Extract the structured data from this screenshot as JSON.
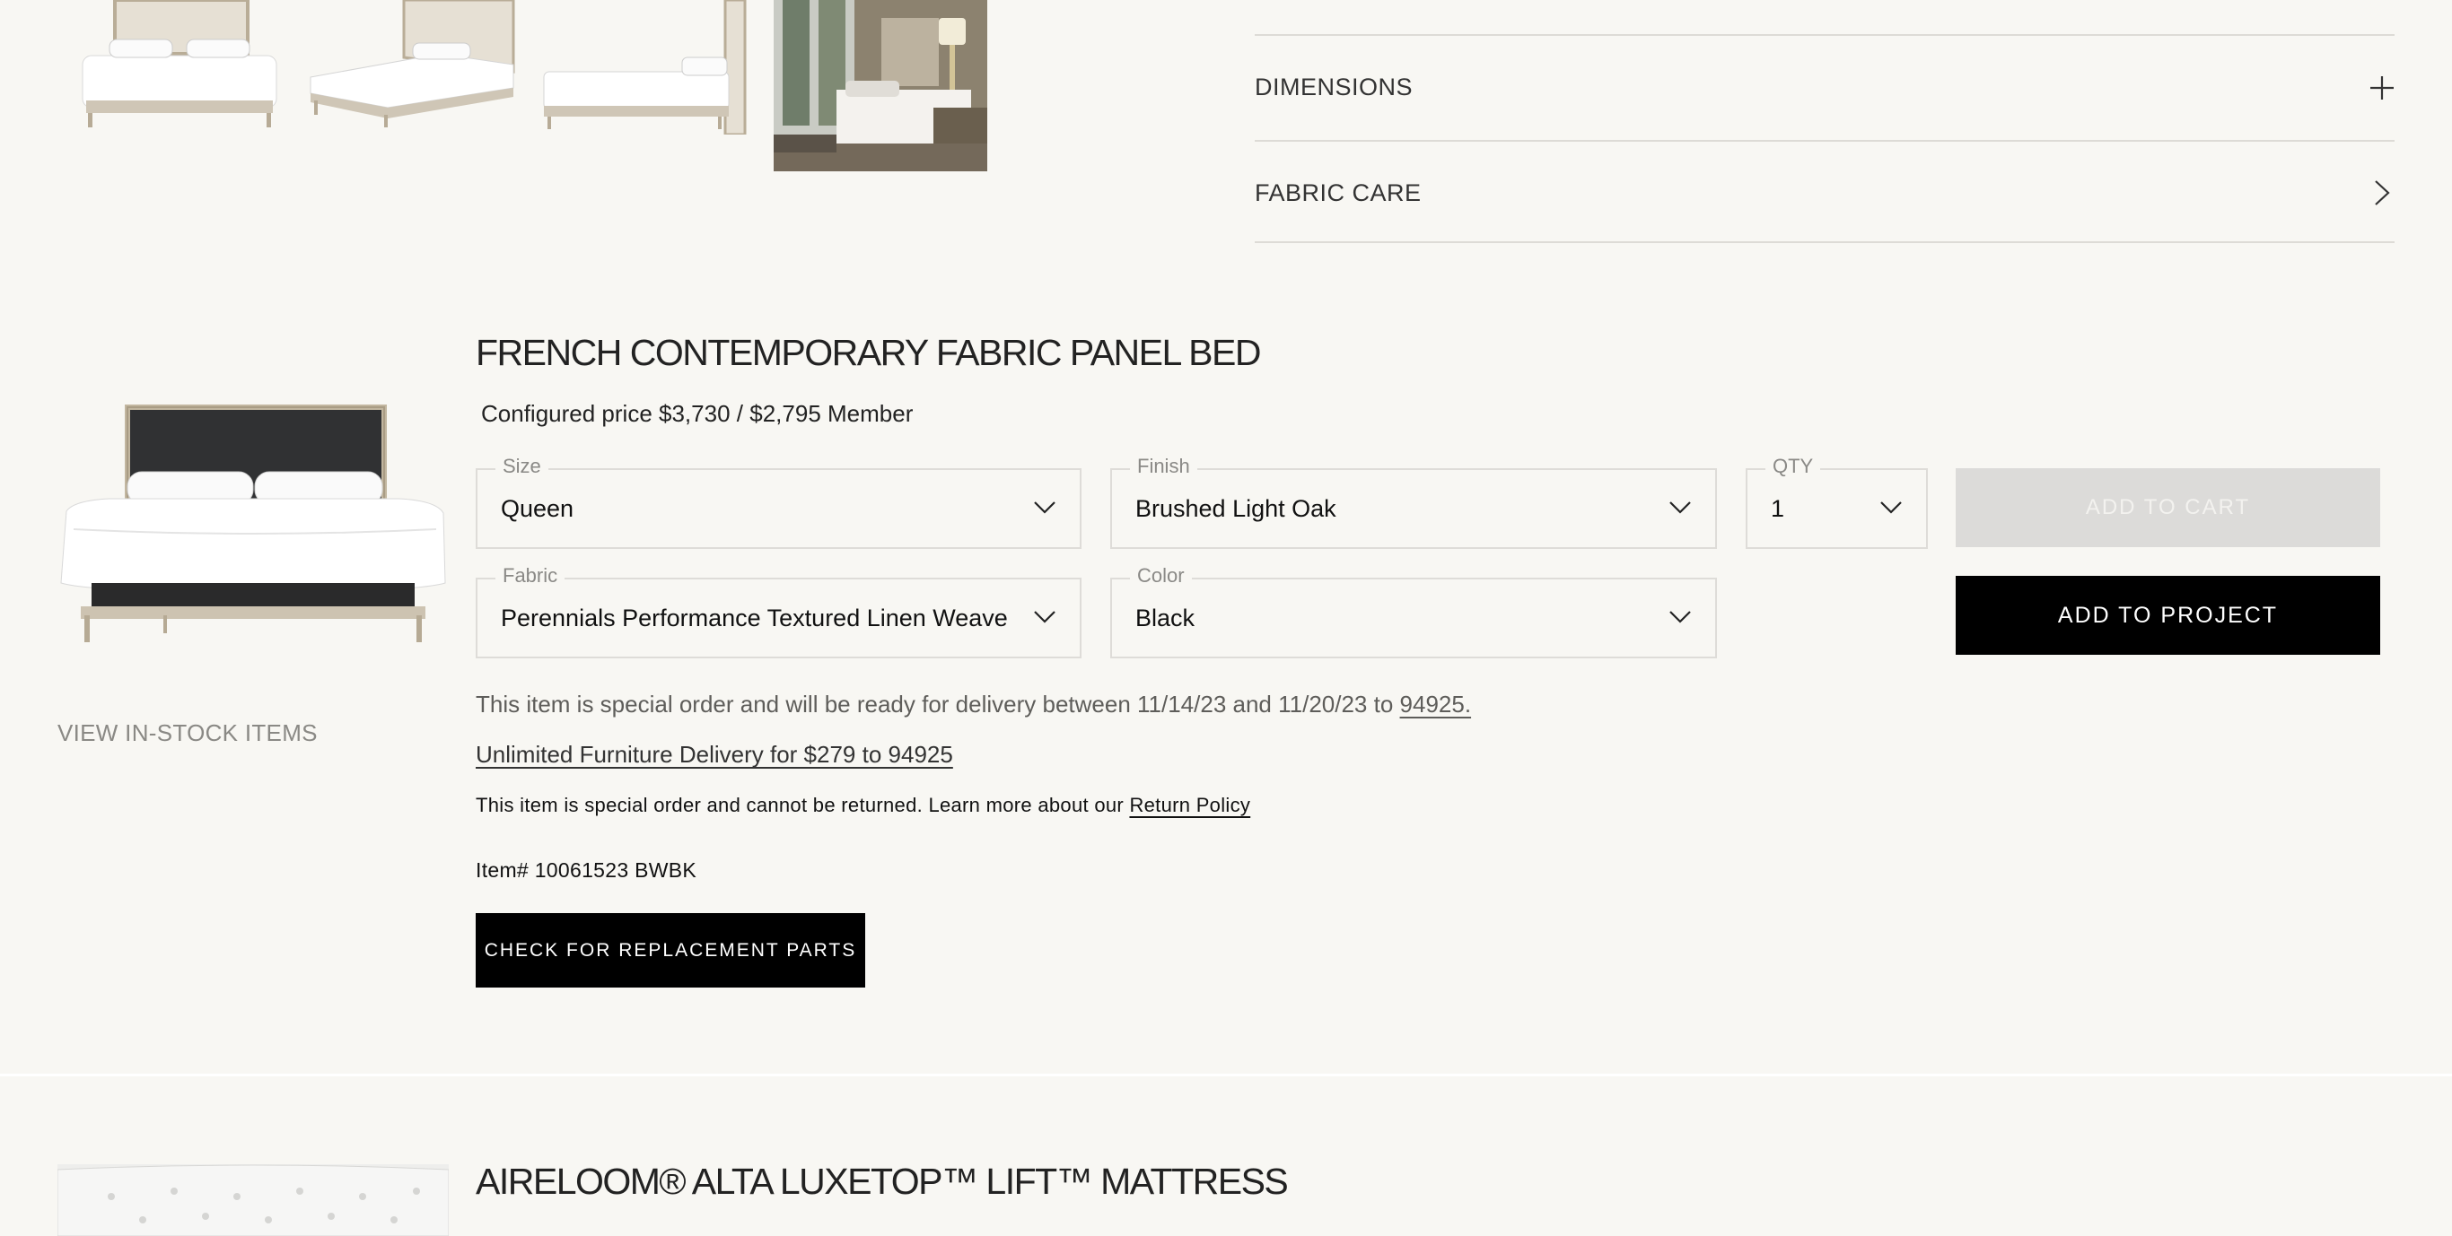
{
  "accordion": [
    {
      "label": "DIMENSIONS",
      "icon": "plus-icon"
    },
    {
      "label": "FABRIC CARE",
      "icon": "chevron-right-icon"
    }
  ],
  "thumbnails": [
    "bed-thumbnail-front",
    "bed-thumbnail-angle",
    "bed-thumbnail-side",
    "bedroom-scene-thumbnail"
  ],
  "product": {
    "title": "FRENCH CONTEMPORARY FABRIC PANEL BED",
    "price_prefix": "Configured price",
    "price_regular": "$3,730",
    "price_sep": "/",
    "price_member": "$2,795 Member",
    "view_instock": "VIEW IN-STOCK ITEMS",
    "options": {
      "size": {
        "label": "Size",
        "value": "Queen"
      },
      "finish": {
        "label": "Finish",
        "value": "Brushed Light Oak"
      },
      "qty": {
        "label": "QTY",
        "value": "1"
      },
      "fabric": {
        "label": "Fabric",
        "value": "Perennials Performance Textured Linen Weave"
      },
      "color": {
        "label": "Color",
        "value": "Black"
      }
    },
    "add_to_cart": "ADD TO CART",
    "add_to_project": "ADD TO PROJECT",
    "delivery_text": "This item is special order and will be ready for delivery between 11/14/23 and 11/20/23 to",
    "delivery_zip": "94925.",
    "unlimited_delivery": "Unlimited Furniture Delivery for $279 to 94925",
    "return_text": "This item is special order and cannot be returned. Learn more about our",
    "return_link": "Return Policy",
    "item_number": "Item# 10061523 BWBK",
    "replacement_parts": "CHECK FOR REPLACEMENT PARTS"
  },
  "next_product": {
    "title": "AIRELOOM® ALTA LUXETOP™ LIFT™ MATTRESS"
  },
  "colors": {
    "background": "#f8f7f3",
    "button_black": "#000000",
    "button_disabled": "#dcdbd9",
    "border": "#dedcd8"
  }
}
